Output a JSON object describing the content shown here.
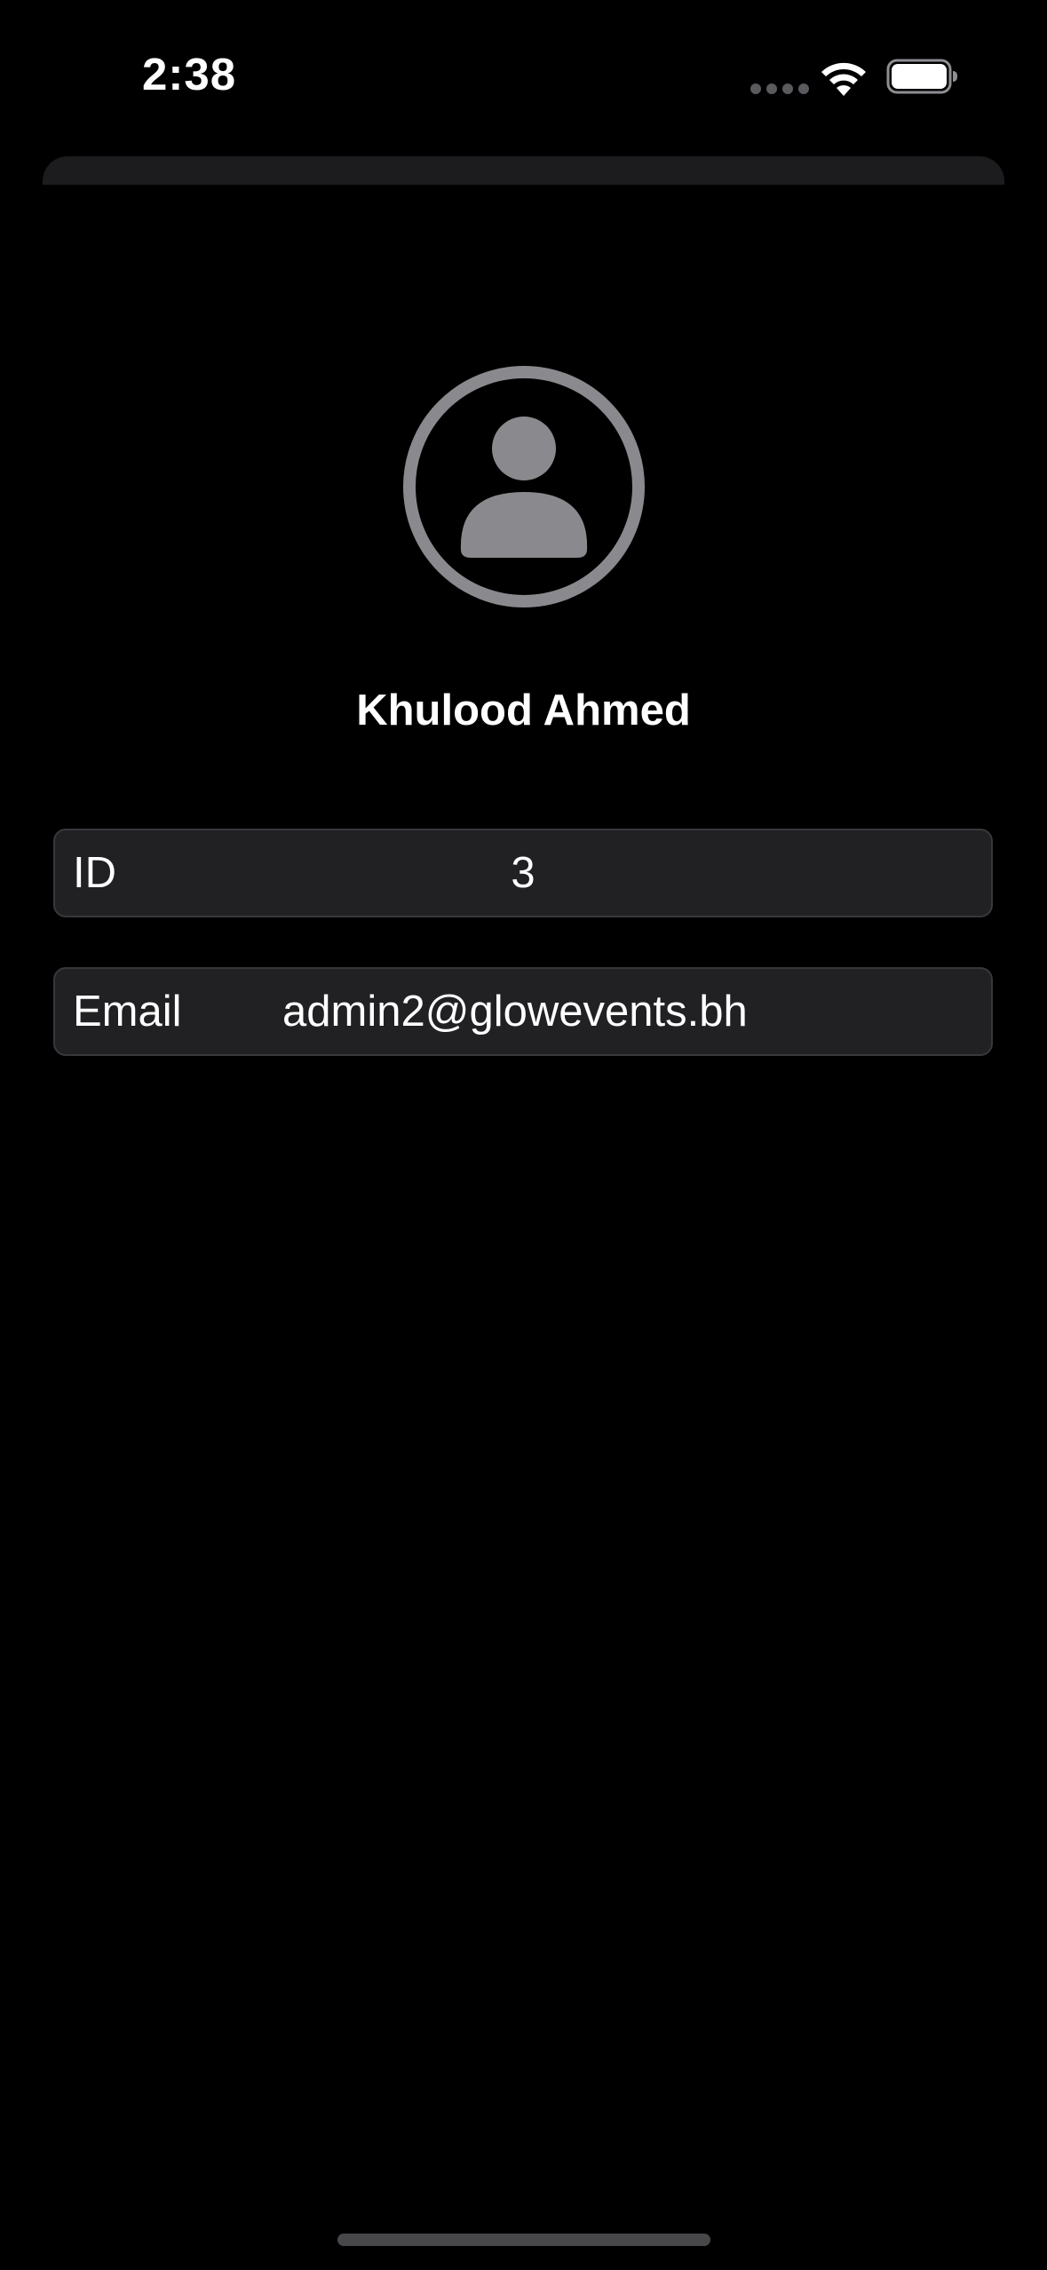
{
  "status_bar": {
    "time": "2:38"
  },
  "icons": {
    "wifi": "wifi-icon",
    "battery": "battery-icon",
    "avatar": "person-circle-icon"
  },
  "profile": {
    "name": "Khulood Ahmed",
    "fields": [
      {
        "label": "ID",
        "value": "3"
      },
      {
        "label": "Email",
        "value": "admin2@glowevents.bh"
      }
    ]
  },
  "colors": {
    "background": "#000000",
    "field_background": "#212124",
    "avatar_gray": "#8a8a8e",
    "text": "#ffffff"
  }
}
